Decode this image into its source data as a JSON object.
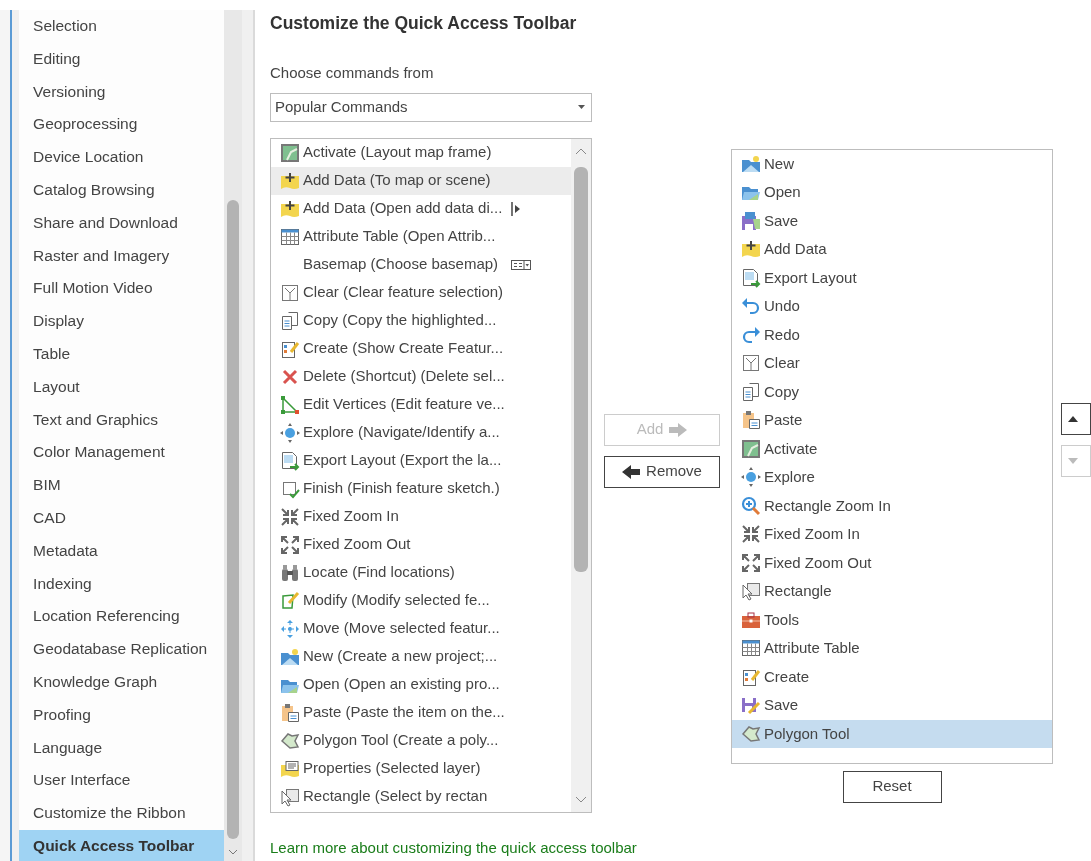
{
  "sidebar": {
    "items": [
      {
        "label": "Selection",
        "selected": false
      },
      {
        "label": "Editing",
        "selected": false
      },
      {
        "label": "Versioning",
        "selected": false
      },
      {
        "label": "Geoprocessing",
        "selected": false
      },
      {
        "label": "Device Location",
        "selected": false
      },
      {
        "label": "Catalog Browsing",
        "selected": false
      },
      {
        "label": "Share and Download",
        "selected": false
      },
      {
        "label": "Raster and Imagery",
        "selected": false
      },
      {
        "label": "Full Motion Video",
        "selected": false
      },
      {
        "label": "Display",
        "selected": false
      },
      {
        "label": "Table",
        "selected": false
      },
      {
        "label": "Layout",
        "selected": false
      },
      {
        "label": "Text and Graphics",
        "selected": false
      },
      {
        "label": "Color Management",
        "selected": false
      },
      {
        "label": "BIM",
        "selected": false
      },
      {
        "label": "CAD",
        "selected": false
      },
      {
        "label": "Metadata",
        "selected": false
      },
      {
        "label": "Indexing",
        "selected": false
      },
      {
        "label": "Location Referencing",
        "selected": false
      },
      {
        "label": "Geodatabase Replication",
        "selected": false
      },
      {
        "label": "Knowledge Graph",
        "selected": false
      },
      {
        "label": "Proofing",
        "selected": false
      },
      {
        "label": "Language",
        "selected": false
      },
      {
        "label": "User Interface",
        "selected": false
      },
      {
        "label": "Customize the Ribbon",
        "selected": false
      },
      {
        "label": "Quick Access Toolbar",
        "selected": true
      }
    ]
  },
  "title": "Customize the Quick Access Toolbar",
  "command_source": {
    "label": "Choose commands from",
    "value": "Popular Commands"
  },
  "commands": [
    {
      "label": "Activate (Layout map frame)",
      "kind": "map",
      "hovered": false
    },
    {
      "label": "Add Data (To map or scene)",
      "kind": "adddata",
      "hovered": true
    },
    {
      "label": "Add Data (Open add data di...",
      "kind": "adddata",
      "hovered": false,
      "split": true
    },
    {
      "label": "Attribute Table (Open Attrib...",
      "kind": "table",
      "hovered": false
    },
    {
      "label": "Basemap (Choose basemap)",
      "kind": "none",
      "hovered": false,
      "gallery": true
    },
    {
      "label": "Clear (Clear feature selection)",
      "kind": "clear",
      "hovered": false
    },
    {
      "label": "Copy (Copy the highlighted...",
      "kind": "copy",
      "hovered": false
    },
    {
      "label": "Create (Show Create Featur...",
      "kind": "create",
      "hovered": false
    },
    {
      "label": "Delete (Shortcut) (Delete sel...",
      "kind": "delete",
      "hovered": false
    },
    {
      "label": "Edit Vertices (Edit feature ve...",
      "kind": "vertices",
      "hovered": false
    },
    {
      "label": "Explore (Navigate/Identify a...",
      "kind": "explore",
      "hovered": false
    },
    {
      "label": "Export Layout (Export the la...",
      "kind": "export",
      "hovered": false
    },
    {
      "label": "Finish (Finish feature sketch.)",
      "kind": "finish",
      "hovered": false
    },
    {
      "label": "Fixed Zoom In",
      "kind": "zoomin",
      "hovered": false
    },
    {
      "label": "Fixed Zoom Out",
      "kind": "zoomout",
      "hovered": false
    },
    {
      "label": "Locate (Find locations)",
      "kind": "locate",
      "hovered": false
    },
    {
      "label": "Modify (Modify selected fe...",
      "kind": "modify",
      "hovered": false
    },
    {
      "label": "Move (Move selected featur...",
      "kind": "move",
      "hovered": false
    },
    {
      "label": "New (Create a new project;...",
      "kind": "new",
      "hovered": false
    },
    {
      "label": "Open (Open an existing pro...",
      "kind": "open",
      "hovered": false
    },
    {
      "label": "Paste (Paste the item on the...",
      "kind": "paste",
      "hovered": false
    },
    {
      "label": "Polygon Tool (Create a poly...",
      "kind": "polygon",
      "hovered": false
    },
    {
      "label": "Properties (Selected layer)",
      "kind": "properties",
      "hovered": false
    },
    {
      "label": "Rectangle (Select by rectan",
      "kind": "rectangle",
      "hovered": false
    }
  ],
  "add_button": {
    "label": "Add",
    "disabled": true
  },
  "remove_button": {
    "label": "Remove",
    "disabled": false
  },
  "toolbar_commands": [
    {
      "label": "New",
      "kind": "new",
      "selected": false
    },
    {
      "label": "Open",
      "kind": "open",
      "selected": false
    },
    {
      "label": "Save",
      "kind": "save",
      "selected": false
    },
    {
      "label": "Add Data",
      "kind": "adddata",
      "selected": false
    },
    {
      "label": "Export Layout",
      "kind": "export",
      "selected": false
    },
    {
      "label": "Undo",
      "kind": "undo",
      "selected": false
    },
    {
      "label": "Redo",
      "kind": "redo",
      "selected": false
    },
    {
      "label": "Clear",
      "kind": "clear",
      "selected": false
    },
    {
      "label": "Copy",
      "kind": "copy",
      "selected": false
    },
    {
      "label": "Paste",
      "kind": "paste",
      "selected": false
    },
    {
      "label": "Activate",
      "kind": "map",
      "selected": false
    },
    {
      "label": "Explore",
      "kind": "explore",
      "selected": false
    },
    {
      "label": "Rectangle Zoom In",
      "kind": "magnify",
      "selected": false
    },
    {
      "label": "Fixed Zoom In",
      "kind": "zoomin",
      "selected": false
    },
    {
      "label": "Fixed Zoom Out",
      "kind": "zoomout",
      "selected": false
    },
    {
      "label": "Rectangle",
      "kind": "rectangle",
      "selected": false
    },
    {
      "label": "Tools",
      "kind": "tools",
      "selected": false
    },
    {
      "label": "Attribute Table",
      "kind": "table",
      "selected": false
    },
    {
      "label": "Create",
      "kind": "create",
      "selected": false
    },
    {
      "label": "Save",
      "kind": "savepen",
      "selected": false
    },
    {
      "label": "Polygon Tool",
      "kind": "polygon",
      "selected": true
    }
  ],
  "reset_button": {
    "label": "Reset"
  },
  "move_up_button": {
    "disabled": false
  },
  "move_down_button": {
    "disabled": true
  },
  "learn_more_link": "Learn more about customizing the quick access toolbar"
}
